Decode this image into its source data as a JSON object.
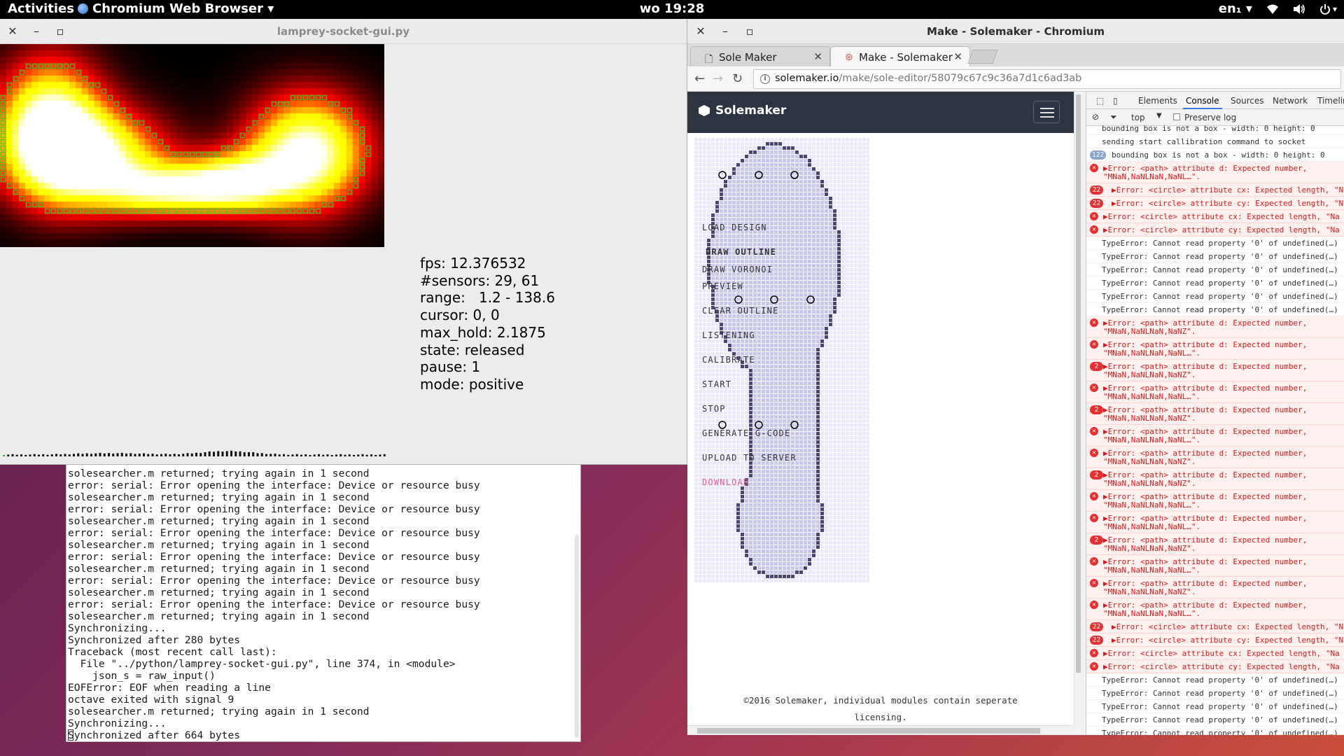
{
  "topbar": {
    "activities": "Activities",
    "app_menu": "Chromium Web Browser ▾",
    "clock": "wo 19:28",
    "lang": "en₁ ▾",
    "tray_icons": [
      "wifi-icon",
      "volume-icon",
      "power-icon"
    ]
  },
  "lamprey": {
    "title": "lamprey-socket-gui.py",
    "stats": [
      "fps: 12.376532",
      "#sensors: 29, 61",
      "range:   1.2 - 138.6",
      "cursor: 0, 0",
      "max_hold: 2.1875",
      "state: released",
      "pause: 1",
      "mode: positive"
    ]
  },
  "terminal": {
    "lines": [
      "solesearcher.m returned; trying again in 1 second",
      "error: serial: Error opening the interface: Device or resource busy",
      "solesearcher.m returned; trying again in 1 second",
      "error: serial: Error opening the interface: Device or resource busy",
      "solesearcher.m returned; trying again in 1 second",
      "error: serial: Error opening the interface: Device or resource busy",
      "solesearcher.m returned; trying again in 1 second",
      "error: serial: Error opening the interface: Device or resource busy",
      "solesearcher.m returned; trying again in 1 second",
      "error: serial: Error opening the interface: Device or resource busy",
      "solesearcher.m returned; trying again in 1 second",
      "error: serial: Error opening the interface: Device or resource busy",
      "solesearcher.m returned; trying again in 1 second",
      "Synchronizing...",
      "Synchronized after 280 bytes",
      "Traceback (most recent call last):",
      "  File \"../python/lamprey-socket-gui.py\", line 374, in <module>",
      "    json_s = raw_input()",
      "EOFError: EOF when reading a line",
      "octave exited with signal 9",
      "solesearcher.m returned; trying again in 1 second",
      "Synchronizing...",
      "Synchronized after 664 bytes"
    ]
  },
  "chromium": {
    "title": "Make - Solemaker - Chromium",
    "tabs": [
      {
        "label": "Sole Maker",
        "active": false
      },
      {
        "label": "Make - Solemaker",
        "active": true
      }
    ],
    "url_host": "solemaker.io",
    "url_path": "/make/sole-editor/58079c67c9c36a7d1c6ad3ab"
  },
  "solemaker": {
    "brand": "Solemaker",
    "menu": [
      "LOAD DESIGN",
      "DRAW OUTLINE",
      "DRAW VORONOI",
      "PREVIEW",
      "CLEAR OUTLINE",
      "LISTENING",
      "CALIBRATE",
      "START",
      "STOP",
      "GENERATE G-CODE",
      "UPLOAD TO SERVER",
      "DOWNLOAD"
    ],
    "footer_line1": "©2016 Solemaker, individual modules contain seperate",
    "footer_line2": "licensing."
  },
  "devtools": {
    "tabs": [
      "Elements",
      "Console",
      "Sources",
      "Network",
      "Timelin"
    ],
    "active_tab": "Console",
    "context": "top",
    "preserve_log": "Preserve log",
    "log": [
      {
        "type": "info",
        "badge": "",
        "text": "bounding box is not a box - width: 0 height: 0",
        "text2": ""
      },
      {
        "type": "info",
        "badge": "",
        "text": "sending start callibration command to socket",
        "text2": ""
      },
      {
        "type": "info",
        "badge": "122",
        "text": "bounding box is not a box - width: 0 height: 0",
        "text2": ""
      },
      {
        "type": "err",
        "badge": "x",
        "text": "▶Error: <path> attribute d: Expected number,",
        "text2": "\"MNaN,NaNLNaN,NaNL…\"."
      },
      {
        "type": "err",
        "badge": "22",
        "text": "▶Error: <circle> attribute cx: Expected length, \"N",
        "text2": ""
      },
      {
        "type": "err",
        "badge": "22",
        "text": "▶Error: <circle> attribute cy: Expected length, \"N",
        "text2": ""
      },
      {
        "type": "err",
        "badge": "x",
        "text": "▶Error: <circle> attribute cx: Expected length, \"Na",
        "text2": ""
      },
      {
        "type": "err",
        "badge": "x",
        "text": "▶Error: <circle> attribute cy: Expected length, \"Na",
        "text2": ""
      },
      {
        "type": "plain",
        "badge": "",
        "text": "TypeError: Cannot read property '0' of undefined(…)",
        "text2": ""
      },
      {
        "type": "plain",
        "badge": "",
        "text": "TypeError: Cannot read property '0' of undefined(…)",
        "text2": ""
      },
      {
        "type": "plain",
        "badge": "",
        "text": "TypeError: Cannot read property '0' of undefined(…)",
        "text2": ""
      },
      {
        "type": "plain",
        "badge": "",
        "text": "TypeError: Cannot read property '0' of undefined(…)",
        "text2": ""
      },
      {
        "type": "plain",
        "badge": "",
        "text": "TypeError: Cannot read property '0' of undefined(…)",
        "text2": ""
      },
      {
        "type": "plain",
        "badge": "",
        "text": "TypeError: Cannot read property '0' of undefined(…)",
        "text2": ""
      },
      {
        "type": "err",
        "badge": "x",
        "text": "▶Error: <path> attribute d: Expected number,",
        "text2": "\"MNaN,NaNLNaN,NaNZ\"."
      },
      {
        "type": "err",
        "badge": "x",
        "text": "▶Error: <path> attribute d: Expected number,",
        "text2": "\"MNaN,NaNLNaN,NaNL…\"."
      },
      {
        "type": "err",
        "badge": "2",
        "text": "▶Error: <path> attribute d: Expected number,",
        "text2": "\"MNaN,NaNLNaN,NaNZ\"."
      },
      {
        "type": "err",
        "badge": "x",
        "text": "▶Error: <path> attribute d: Expected number,",
        "text2": "\"MNaN,NaNLNaN,NaNL…\"."
      },
      {
        "type": "err",
        "badge": "2",
        "text": "▶Error: <path> attribute d: Expected number,",
        "text2": "\"MNaN,NaNLNaN,NaNZ\"."
      },
      {
        "type": "err",
        "badge": "x",
        "text": "▶Error: <path> attribute d: Expected number,",
        "text2": "\"MNaN,NaNLNaN,NaNL…\"."
      },
      {
        "type": "err",
        "badge": "x",
        "text": "▶Error: <path> attribute d: Expected number,",
        "text2": "\"MNaN,NaNLNaN,NaNZ\"."
      },
      {
        "type": "err",
        "badge": "2",
        "text": "▶Error: <path> attribute d: Expected number,",
        "text2": "\"MNaN,NaNLNaN,NaNZ\"."
      },
      {
        "type": "err",
        "badge": "x",
        "text": "▶Error: <path> attribute d: Expected number,",
        "text2": "\"MNaN,NaNLNaN,NaNL…\"."
      },
      {
        "type": "err",
        "badge": "x",
        "text": "▶Error: <path> attribute d: Expected number,",
        "text2": "\"MNaN,NaNLNaN,NaNL…\"."
      },
      {
        "type": "err",
        "badge": "2",
        "text": "▶Error: <path> attribute d: Expected number,",
        "text2": "\"MNaN,NaNLNaN,NaNZ\"."
      },
      {
        "type": "err",
        "badge": "x",
        "text": "▶Error: <path> attribute d: Expected number,",
        "text2": "\"MNaN,NaNLNaN,NaNL…\"."
      },
      {
        "type": "err",
        "badge": "x",
        "text": "▶Error: <path> attribute d: Expected number,",
        "text2": "\"MNaN,NaNLNaN,NaNZ\"."
      },
      {
        "type": "err",
        "badge": "x",
        "text": "▶Error: <path> attribute d: Expected number,",
        "text2": "\"MNaN,NaNLNaN,NaNL…\"."
      },
      {
        "type": "err",
        "badge": "22",
        "text": "▶Error: <circle> attribute cx: Expected length, \"N",
        "text2": ""
      },
      {
        "type": "err",
        "badge": "22",
        "text": "▶Error: <circle> attribute cy: Expected length, \"N",
        "text2": ""
      },
      {
        "type": "err",
        "badge": "x",
        "text": "▶Error: <circle> attribute cx: Expected length, \"Na",
        "text2": ""
      },
      {
        "type": "err",
        "badge": "x",
        "text": "▶Error: <circle> attribute cy: Expected length, \"Na",
        "text2": ""
      },
      {
        "type": "plain",
        "badge": "",
        "text": "TypeError: Cannot read property '0' of undefined(…)",
        "text2": ""
      },
      {
        "type": "plain",
        "badge": "",
        "text": "TypeError: Cannot read property '0' of undefined(…)",
        "text2": ""
      },
      {
        "type": "plain",
        "badge": "",
        "text": "TypeError: Cannot read property '0' of undefined(…)",
        "text2": ""
      },
      {
        "type": "plain",
        "badge": "",
        "text": "TypeError: Cannot read property '0' of undefined(…)",
        "text2": ""
      },
      {
        "type": "plain",
        "badge": "",
        "text": "TypeError: Cannot read property '0' of undefined(…)",
        "text2": ""
      }
    ]
  },
  "colors": {
    "topbar": "#000000",
    "solemaker_header": "#2b3440",
    "devtools_accent": "#3879d9",
    "error_red": "#e43030",
    "download_pink": "#e85a8a"
  }
}
